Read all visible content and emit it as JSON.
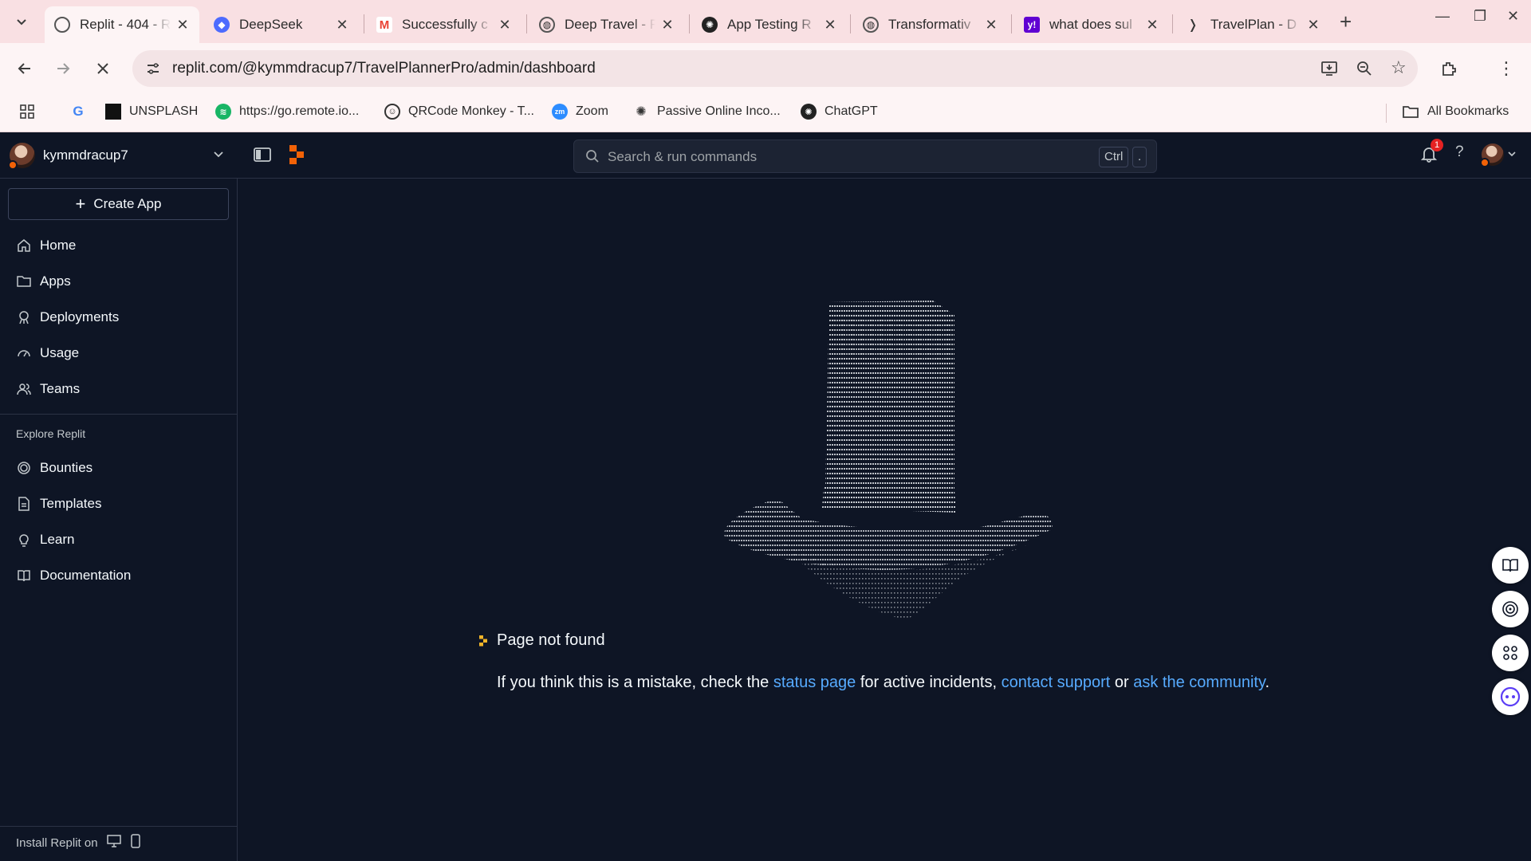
{
  "browser": {
    "tabs": [
      {
        "title": "Replit - 404 - R",
        "favicon": "replit-icon",
        "active": true
      },
      {
        "title": "DeepSeek",
        "favicon": "deepseek-icon"
      },
      {
        "title": "Successfully c",
        "favicon": "gmail-icon"
      },
      {
        "title": "Deep Travel - F",
        "favicon": "globe-icon"
      },
      {
        "title": "App Testing R",
        "favicon": "openai-icon"
      },
      {
        "title": "Transformativ",
        "favicon": "globe-icon"
      },
      {
        "title": "what does sul",
        "favicon": "yahoo-icon"
      },
      {
        "title": "TravelPlan - D",
        "favicon": "travelplan-icon"
      }
    ],
    "url": "replit.com/@kymmdracup7/TravelPlannerPro/admin/dashboard",
    "bookmarks": [
      {
        "label": "",
        "icon": "google-icon"
      },
      {
        "label": "UNSPLASH",
        "icon": "unsplash-icon"
      },
      {
        "label": "https://go.remote.io...",
        "icon": "remote-icon"
      },
      {
        "label": "QRCode Monkey - T...",
        "icon": "qrcode-monkey-icon"
      },
      {
        "label": "Zoom",
        "icon": "zoom-icon"
      },
      {
        "label": "Passive Online Inco...",
        "icon": "openai-icon"
      },
      {
        "label": "ChatGPT",
        "icon": "chatgpt-icon"
      }
    ],
    "all_bookmarks": "All Bookmarks"
  },
  "topbar": {
    "username": "kymmdracup7",
    "search_placeholder": "Search & run commands",
    "shortcut_key1": "Ctrl",
    "shortcut_key2": ".",
    "notification_count": "1",
    "help_label": "?"
  },
  "sidebar": {
    "create_app": "Create App",
    "items": [
      {
        "label": "Home",
        "icon": "home-icon"
      },
      {
        "label": "Apps",
        "icon": "folder-icon"
      },
      {
        "label": "Deployments",
        "icon": "deployments-icon"
      },
      {
        "label": "Usage",
        "icon": "gauge-icon"
      },
      {
        "label": "Teams",
        "icon": "users-icon"
      }
    ],
    "explore_heading": "Explore Replit",
    "explore_items": [
      {
        "label": "Bounties",
        "icon": "bounties-icon"
      },
      {
        "label": "Templates",
        "icon": "templates-icon"
      },
      {
        "label": "Learn",
        "icon": "lightbulb-icon"
      },
      {
        "label": "Documentation",
        "icon": "book-icon"
      }
    ],
    "install_label": "Install Replit on"
  },
  "main": {
    "not_found": "Page not found",
    "message_prefix": "If you think this is a mistake, check the",
    "status_link": "status page",
    "message_mid1": "for active incidents,",
    "support_link": "contact support",
    "message_mid2": "or",
    "community_link": "ask the community",
    "message_suffix": "."
  },
  "colors": {
    "background": "#0e1525",
    "link": "#57abff",
    "accent": "#f26207",
    "tabbar": "#f9e0e3"
  }
}
